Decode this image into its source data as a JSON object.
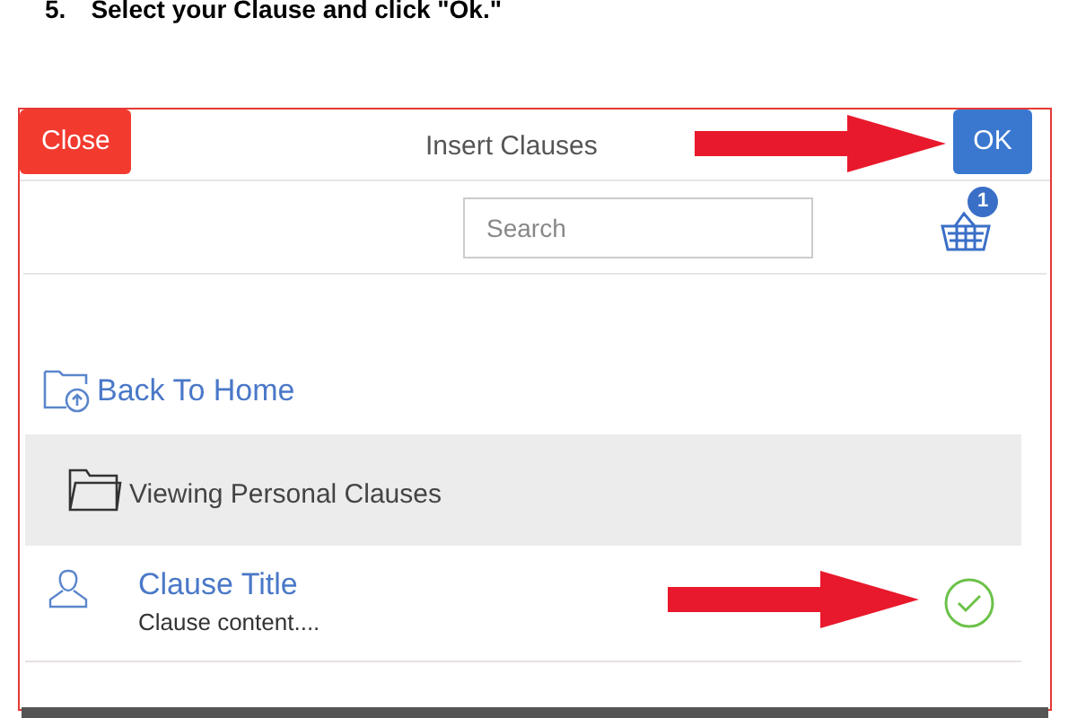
{
  "instruction": {
    "number": "5.",
    "text": "Select your Clause and click \"Ok.\""
  },
  "dialog": {
    "title": "Insert Clauses",
    "close_button": "Close",
    "ok_button": "OK",
    "search": {
      "placeholder": "Search"
    },
    "basket": {
      "count": "1"
    },
    "back_link": "Back To Home",
    "folder": {
      "label": "Viewing Personal Clauses"
    },
    "clauses": [
      {
        "title": "Clause Title",
        "content": "Clause content....",
        "checked": true
      }
    ]
  }
}
